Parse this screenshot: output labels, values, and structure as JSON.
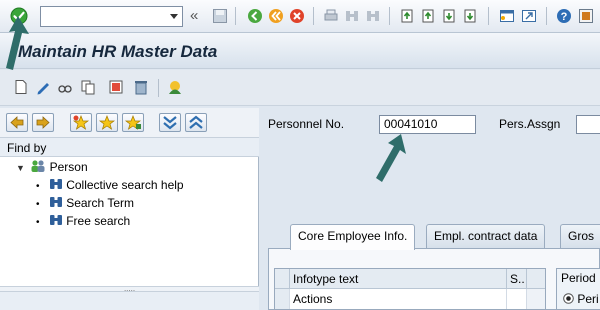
{
  "system_toolbar": {
    "command_field_value": "",
    "icons": [
      "enter-icon",
      "dropdown-icon",
      "back-double-arrow-icon",
      "save-icon",
      "back-icon",
      "exit-icon",
      "cancel-icon",
      "print-icon",
      "find-icon",
      "find-next-icon",
      "first-page-icon",
      "previous-page-icon",
      "next-page-icon",
      "last-page-icon",
      "new-session-icon",
      "shortcut-icon",
      "help-icon",
      "customize-layout-icon"
    ]
  },
  "title_bar": {
    "title": "Maintain HR Master Data"
  },
  "app_toolbar": {
    "icons": [
      "create-icon",
      "change-icon",
      "display-icon",
      "copy-icon",
      "delimit-icon",
      "delete-icon",
      "overview-icon"
    ]
  },
  "left_panel": {
    "find_by_label": "Find by",
    "tree": {
      "root_label": "Person",
      "items": [
        {
          "label": "Collective search help"
        },
        {
          "label": "Search Term"
        },
        {
          "label": "Free search"
        }
      ]
    }
  },
  "header_fields": {
    "personnel_no_label": "Personnel No.",
    "personnel_no_value": "00041010",
    "pers_assgn_label": "Pers.Assgn"
  },
  "tabs": [
    {
      "label": "Core Employee Info.",
      "active": true
    },
    {
      "label": "Empl. contract data",
      "active": false
    },
    {
      "label": "Gros",
      "active": false
    }
  ],
  "infotype_table": {
    "columns": [
      "Infotype text",
      "S.."
    ],
    "rows": [
      "Actions"
    ]
  },
  "period": {
    "label": "Period",
    "option_label": "Peri"
  },
  "colors": {
    "title_text": "#16283d",
    "arrow": "#2f6d6a",
    "accent_green": "#3aa53a"
  }
}
